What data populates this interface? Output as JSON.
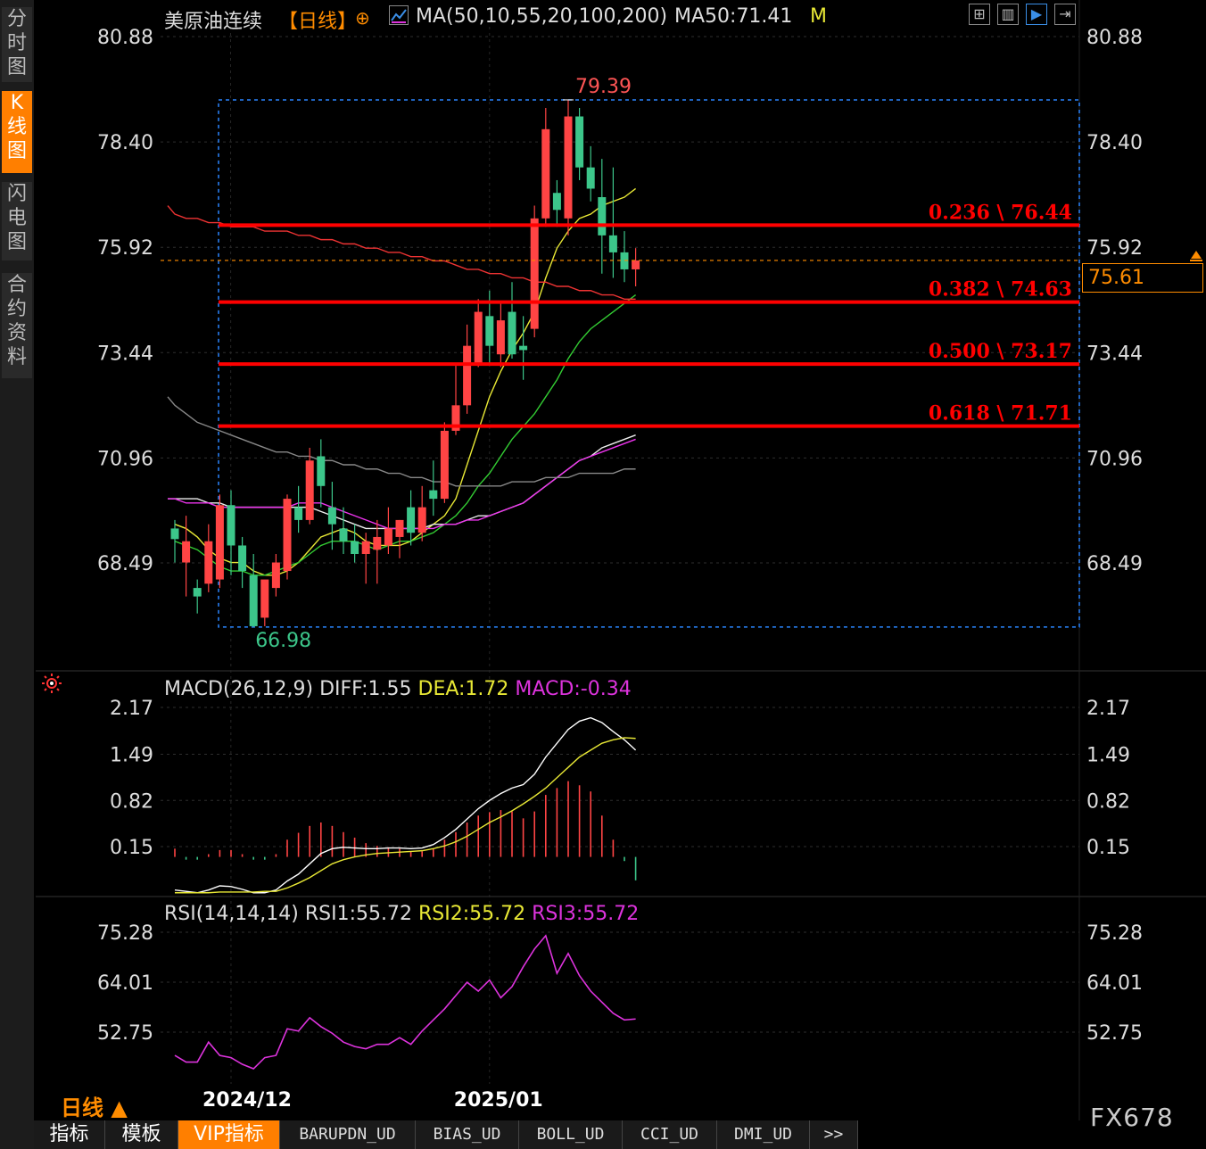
{
  "sidebar": {
    "tabs": [
      {
        "label": "分时图",
        "active": false
      },
      {
        "label": "K线图",
        "active": true
      },
      {
        "label": "闪电图",
        "active": false
      },
      {
        "label": "合约资料",
        "active": false
      }
    ]
  },
  "header": {
    "title": "美原油连续",
    "period_tag": "【日线】",
    "ma_label": "MA(50,10,55,20,100,200)",
    "ma50_label": "MA50:71.41",
    "m_label": "M"
  },
  "toolbar": {
    "icons": [
      "grid-icon",
      "bar-chart-icon",
      "play-icon",
      "expand-icon"
    ]
  },
  "colors": {
    "up": "#ff4444",
    "down": "#3cc68a",
    "fib": "#ff0000",
    "diff": "#ffffff",
    "dea": "#e8e835",
    "macd_title": "#dddddd",
    "rsi": "#dd33dd",
    "ma_yellow": "#e8e835",
    "ma_green": "#33cc33",
    "ma_white": "#eeeeee",
    "ma_magenta": "#ee33ee",
    "ma_gray": "#888888",
    "ma_red": "#ee3333",
    "current": "#ff8c00",
    "box": "#2a86ff"
  },
  "current_price": "75.61",
  "bottom_tabs": [
    {
      "label": "指标",
      "active": false,
      "kind": "cn"
    },
    {
      "label": "模板",
      "active": false,
      "kind": "cn"
    },
    {
      "label": "VIP指标",
      "active": true,
      "kind": "cn"
    },
    {
      "label": "BARUPDN_UD",
      "active": false,
      "kind": "en"
    },
    {
      "label": "BIAS_UD",
      "active": false,
      "kind": "en"
    },
    {
      "label": "BOLL_UD",
      "active": false,
      "kind": "en"
    },
    {
      "label": "CCI_UD",
      "active": false,
      "kind": "en"
    },
    {
      "label": "DMI_UD",
      "active": false,
      "kind": "en"
    },
    {
      "label": ">>",
      "active": false,
      "kind": "en"
    }
  ],
  "period_label": "日线 ▲",
  "watermark": "FX678",
  "chart_data": [
    {
      "type": "candlestick",
      "name": "price",
      "ylim": [
        66.0,
        81.2
      ],
      "y_ticks": [
        "80.88",
        "78.40",
        "75.92",
        "73.44",
        "70.96",
        "68.49"
      ],
      "x_ticks": [
        "2024/12",
        "2025/01"
      ],
      "high_label": "79.39",
      "low_label": "66.98",
      "candles": [
        {
          "o": 69.3,
          "h": 69.5,
          "c": 69.05,
          "l": 68.5
        },
        {
          "o": 68.5,
          "h": 69.6,
          "c": 69.0,
          "l": 67.7
        },
        {
          "o": 67.9,
          "h": 68.1,
          "c": 67.7,
          "l": 67.3
        },
        {
          "o": 68.0,
          "h": 69.4,
          "c": 69.0,
          "l": 67.8
        },
        {
          "o": 68.1,
          "h": 70.1,
          "c": 69.85,
          "l": 67.9
        },
        {
          "o": 69.85,
          "h": 70.2,
          "c": 68.9,
          "l": 68.2
        },
        {
          "o": 68.9,
          "h": 69.1,
          "c": 68.3,
          "l": 67.9
        },
        {
          "o": 68.2,
          "h": 68.7,
          "c": 67.0,
          "l": 66.98
        },
        {
          "o": 67.2,
          "h": 68.0,
          "c": 68.1,
          "l": 67.0
        },
        {
          "o": 67.9,
          "h": 68.7,
          "c": 68.5,
          "l": 67.7
        },
        {
          "o": 68.3,
          "h": 70.1,
          "c": 70.0,
          "l": 68.1
        },
        {
          "o": 69.8,
          "h": 70.3,
          "c": 69.5,
          "l": 69.2
        },
        {
          "o": 69.5,
          "h": 71.2,
          "c": 70.9,
          "l": 69.4
        },
        {
          "o": 71.0,
          "h": 71.4,
          "c": 70.3,
          "l": 69.8
        },
        {
          "o": 69.8,
          "h": 70.4,
          "c": 69.4,
          "l": 68.8
        },
        {
          "o": 69.3,
          "h": 69.8,
          "c": 69.0,
          "l": 68.7
        },
        {
          "o": 69.0,
          "h": 69.4,
          "c": 68.7,
          "l": 68.5
        },
        {
          "o": 68.7,
          "h": 69.2,
          "c": 69.0,
          "l": 68.0
        },
        {
          "o": 68.8,
          "h": 69.5,
          "c": 69.1,
          "l": 68.0
        },
        {
          "o": 68.9,
          "h": 69.8,
          "c": 69.3,
          "l": 68.7
        },
        {
          "o": 69.1,
          "h": 69.5,
          "c": 69.5,
          "l": 68.6
        },
        {
          "o": 69.8,
          "h": 70.2,
          "c": 69.2,
          "l": 68.9
        },
        {
          "o": 69.2,
          "h": 70.3,
          "c": 69.8,
          "l": 69.0
        },
        {
          "o": 70.2,
          "h": 70.9,
          "c": 70.0,
          "l": 69.6
        },
        {
          "o": 70.0,
          "h": 71.8,
          "c": 71.6,
          "l": 69.9
        },
        {
          "o": 71.6,
          "h": 73.2,
          "c": 72.2,
          "l": 71.5
        },
        {
          "o": 72.2,
          "h": 74.1,
          "c": 73.6,
          "l": 72.0
        },
        {
          "o": 73.2,
          "h": 74.7,
          "c": 74.4,
          "l": 73.1
        },
        {
          "o": 74.3,
          "h": 74.9,
          "c": 73.6,
          "l": 73.2
        },
        {
          "o": 73.4,
          "h": 74.6,
          "c": 74.2,
          "l": 73.1
        },
        {
          "o": 74.4,
          "h": 75.1,
          "c": 73.4,
          "l": 73.3
        },
        {
          "o": 73.6,
          "h": 74.3,
          "c": 73.5,
          "l": 72.8
        },
        {
          "o": 74.0,
          "h": 76.9,
          "c": 76.6,
          "l": 73.8
        },
        {
          "o": 76.6,
          "h": 79.2,
          "c": 78.7,
          "l": 76.4
        },
        {
          "o": 77.2,
          "h": 77.5,
          "c": 76.8,
          "l": 76.4
        },
        {
          "o": 76.6,
          "h": 79.39,
          "c": 79.0,
          "l": 76.2
        },
        {
          "o": 79.0,
          "h": 79.2,
          "c": 77.8,
          "l": 77.5
        },
        {
          "o": 77.8,
          "h": 78.3,
          "c": 77.3,
          "l": 77.0
        },
        {
          "o": 77.1,
          "h": 78.0,
          "c": 76.2,
          "l": 75.3
        },
        {
          "o": 76.2,
          "h": 77.8,
          "c": 75.8,
          "l": 75.2
        },
        {
          "o": 75.8,
          "h": 76.3,
          "c": 75.4,
          "l": 75.1
        },
        {
          "o": 75.4,
          "h": 75.9,
          "c": 75.61,
          "l": 75.0
        }
      ],
      "fib_levels": [
        {
          "label": "0.236 \\ 76.44",
          "value": 76.44
        },
        {
          "label": "0.382 \\ 74.63",
          "value": 74.63
        },
        {
          "label": "0.500 \\ 73.17",
          "value": 73.17
        },
        {
          "label": "0.618 \\ 71.71",
          "value": 71.71
        }
      ],
      "moving_averages": {
        "yellow": [
          69.4,
          69.3,
          69.1,
          68.8,
          68.6,
          68.5,
          68.5,
          68.3,
          68.2,
          68.2,
          68.3,
          68.5,
          68.8,
          69.1,
          69.2,
          69.3,
          69.2,
          69.0,
          68.9,
          68.9,
          68.9,
          69.0,
          69.2,
          69.4,
          69.6,
          70.0,
          70.8,
          71.6,
          72.4,
          73.0,
          73.5,
          73.9,
          74.4,
          75.2,
          75.9,
          76.3,
          76.6,
          76.7,
          76.9,
          77.0,
          77.1,
          77.3
        ],
        "green": [
          69.0,
          68.9,
          68.8,
          68.6,
          68.4,
          68.3,
          68.3,
          68.2,
          68.2,
          68.3,
          68.4,
          68.5,
          68.7,
          68.9,
          69.0,
          69.0,
          69.0,
          68.9,
          68.8,
          68.9,
          69.0,
          69.0,
          69.1,
          69.2,
          69.4,
          69.6,
          69.9,
          70.3,
          70.6,
          71.0,
          71.4,
          71.7,
          72.0,
          72.4,
          72.8,
          73.3,
          73.7,
          74.0,
          74.2,
          74.4,
          74.6,
          74.8
        ],
        "white": [
          70.0,
          70.0,
          70.0,
          69.9,
          69.9,
          69.8,
          69.8,
          69.8,
          69.8,
          69.8,
          69.8,
          69.8,
          69.8,
          69.7,
          69.6,
          69.5,
          69.4,
          69.3,
          69.3,
          69.3,
          69.3,
          69.3,
          69.3,
          69.4,
          69.4,
          69.4,
          69.5,
          69.6,
          69.6,
          69.7,
          69.8,
          69.9,
          70.1,
          70.3,
          70.5,
          70.7,
          70.9,
          71.0,
          71.2,
          71.3,
          71.4,
          71.5
        ],
        "magenta": [
          70.0,
          69.9,
          69.9,
          69.9,
          69.8,
          69.8,
          69.8,
          69.8,
          69.8,
          69.8,
          69.8,
          69.9,
          69.9,
          69.9,
          69.8,
          69.7,
          69.6,
          69.5,
          69.4,
          69.3,
          69.3,
          69.3,
          69.3,
          69.3,
          69.4,
          69.4,
          69.5,
          69.5,
          69.6,
          69.7,
          69.8,
          69.9,
          70.1,
          70.3,
          70.5,
          70.7,
          70.9,
          71.0,
          71.1,
          71.2,
          71.3,
          71.4
        ],
        "gray": [
          72.2,
          72.0,
          71.8,
          71.7,
          71.6,
          71.5,
          71.4,
          71.3,
          71.2,
          71.1,
          71.1,
          71.0,
          71.0,
          70.9,
          70.9,
          70.8,
          70.8,
          70.7,
          70.7,
          70.6,
          70.6,
          70.5,
          70.5,
          70.4,
          70.4,
          70.3,
          70.3,
          70.3,
          70.3,
          70.3,
          70.4,
          70.4,
          70.4,
          70.5,
          70.5,
          70.5,
          70.6,
          70.6,
          70.6,
          70.6,
          70.7,
          70.7
        ],
        "red": [
          76.7,
          76.6,
          76.6,
          76.5,
          76.5,
          76.4,
          76.4,
          76.4,
          76.3,
          76.3,
          76.3,
          76.2,
          76.2,
          76.1,
          76.1,
          76.0,
          76.0,
          75.9,
          75.9,
          75.8,
          75.8,
          75.7,
          75.7,
          75.6,
          75.6,
          75.5,
          75.4,
          75.4,
          75.3,
          75.3,
          75.2,
          75.2,
          75.1,
          75.1,
          75.0,
          75.0,
          74.9,
          74.9,
          74.8,
          74.8,
          74.7,
          74.7
        ]
      }
    },
    {
      "type": "bar",
      "name": "MACD",
      "title": "MACD(26,12,9)",
      "diff_label": "DIFF:1.55",
      "dea_label": "DEA:1.72",
      "macd_label": "MACD:-0.34",
      "ylim": [
        -0.7,
        2.5
      ],
      "y_ticks": [
        "2.17",
        "1.49",
        "0.82",
        "0.15"
      ],
      "diff": [
        -0.48,
        -0.5,
        -0.52,
        -0.48,
        -0.42,
        -0.43,
        -0.47,
        -0.52,
        -0.52,
        -0.48,
        -0.35,
        -0.25,
        -0.1,
        0.05,
        0.12,
        0.14,
        0.13,
        0.12,
        0.12,
        0.13,
        0.13,
        0.12,
        0.13,
        0.18,
        0.28,
        0.4,
        0.55,
        0.7,
        0.82,
        0.92,
        1.0,
        1.05,
        1.2,
        1.45,
        1.65,
        1.85,
        1.97,
        2.02,
        1.95,
        1.82,
        1.7,
        1.55
      ],
      "dea": [
        -0.52,
        -0.52,
        -0.52,
        -0.52,
        -0.51,
        -0.51,
        -0.51,
        -0.51,
        -0.5,
        -0.5,
        -0.45,
        -0.38,
        -0.3,
        -0.2,
        -0.1,
        -0.04,
        0.0,
        0.03,
        0.05,
        0.06,
        0.07,
        0.08,
        0.09,
        0.12,
        0.16,
        0.22,
        0.3,
        0.4,
        0.5,
        0.58,
        0.67,
        0.77,
        0.88,
        1.0,
        1.15,
        1.3,
        1.45,
        1.55,
        1.65,
        1.7,
        1.73,
        1.72
      ],
      "macd": [
        0.12,
        -0.04,
        -0.04,
        0.04,
        0.1,
        0.1,
        0.04,
        -0.04,
        -0.04,
        0.04,
        0.25,
        0.35,
        0.45,
        0.5,
        0.45,
        0.36,
        0.28,
        0.2,
        0.16,
        0.14,
        0.12,
        0.08,
        0.08,
        0.12,
        0.25,
        0.36,
        0.5,
        0.6,
        0.65,
        0.68,
        0.66,
        0.56,
        0.66,
        0.9,
        1.0,
        1.1,
        1.04,
        0.95,
        0.6,
        0.25,
        -0.06,
        -0.34
      ]
    },
    {
      "type": "line",
      "name": "RSI",
      "title": "RSI(14,14,14)",
      "rsi1_label": "RSI1:55.72",
      "rsi2_label": "RSI2:55.72",
      "rsi3_label": "RSI3:55.72",
      "ylim": [
        44,
        78
      ],
      "y_ticks": [
        "75.28",
        "64.01",
        "52.75"
      ],
      "values": [
        47.5,
        46.0,
        46.0,
        50.5,
        47.5,
        47.0,
        45.5,
        44.5,
        47.0,
        47.5,
        53.5,
        53.0,
        56.0,
        54.0,
        52.5,
        50.5,
        49.5,
        49.0,
        50.0,
        50.0,
        51.5,
        50.0,
        53.0,
        55.5,
        58.0,
        61.0,
        64.0,
        62.0,
        64.5,
        60.5,
        63.0,
        67.5,
        71.5,
        74.5,
        66.0,
        70.5,
        65.5,
        62.0,
        59.5,
        57.0,
        55.5,
        55.72
      ]
    }
  ]
}
